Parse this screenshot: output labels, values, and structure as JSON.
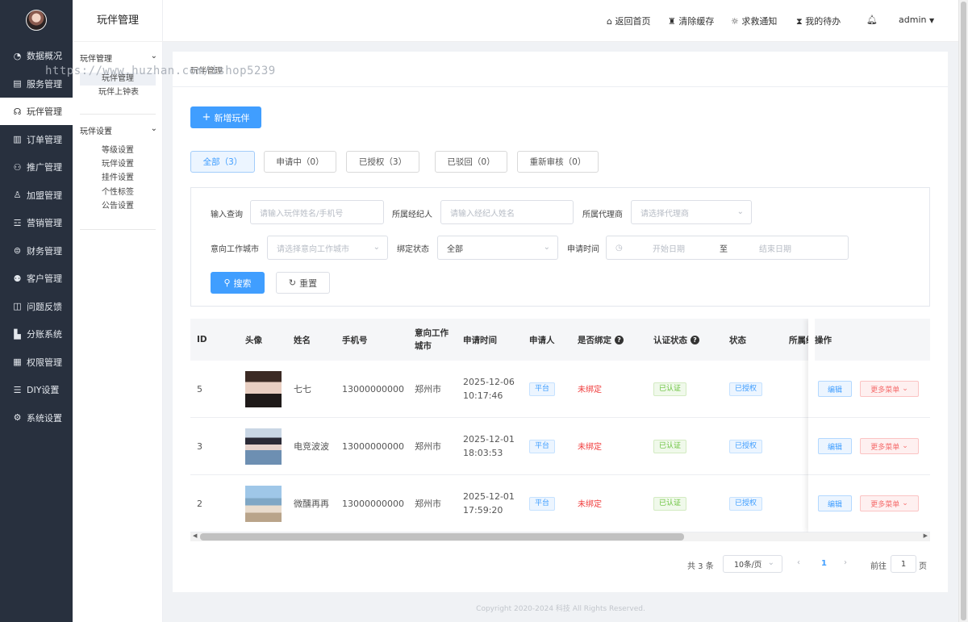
{
  "sidebar": {
    "items": [
      {
        "label": "数据概况",
        "icon": "pie-chart-icon",
        "glyph": "◔"
      },
      {
        "label": "服务管理",
        "icon": "service-icon",
        "glyph": "▤"
      },
      {
        "label": "玩伴管理",
        "icon": "companion-icon",
        "glyph": "☊",
        "active": true
      },
      {
        "label": "订单管理",
        "icon": "order-icon",
        "glyph": "▥"
      },
      {
        "label": "推广管理",
        "icon": "promote-icon",
        "glyph": "⚇"
      },
      {
        "label": "加盟管理",
        "icon": "franchise-icon",
        "glyph": "♙"
      },
      {
        "label": "营销管理",
        "icon": "marketing-icon",
        "glyph": "☲"
      },
      {
        "label": "财务管理",
        "icon": "finance-icon",
        "glyph": "⊜"
      },
      {
        "label": "客户管理",
        "icon": "customer-icon",
        "glyph": "⚉"
      },
      {
        "label": "问题反馈",
        "icon": "feedback-icon",
        "glyph": "◫"
      },
      {
        "label": "分账系统",
        "icon": "split-icon",
        "glyph": "▙"
      },
      {
        "label": "权限管理",
        "icon": "permission-icon",
        "glyph": "▦"
      },
      {
        "label": "DIY设置",
        "icon": "diy-icon",
        "glyph": "☰"
      },
      {
        "label": "系统设置",
        "icon": "settings-icon",
        "glyph": "⚙"
      }
    ]
  },
  "subnav": {
    "title": "玩伴管理",
    "group1": {
      "label": "玩伴管理",
      "items": [
        "玩伴管理",
        "玩伴上钟表"
      ]
    },
    "group2": {
      "label": "玩伴设置",
      "items": [
        "等级设置",
        "玩伴设置",
        "挂件设置",
        "个性标签",
        "公告设置"
      ]
    }
  },
  "topbar": {
    "home": "返回首页",
    "clear_cache": "清除缓存",
    "sos": "求救通知",
    "todo": "我的待办",
    "user": "admin"
  },
  "breadcrumb": "玩伴管理",
  "watermark": "https://www.huzhan.com/ishop5239",
  "add_button": "新增玩伴",
  "tabs": [
    "全部（3）",
    "申请中（0）",
    "已授权（3）",
    "已驳回（0）",
    "重新审核（0）"
  ],
  "filters": {
    "query_label": "输入查询",
    "query_placeholder": "请输入玩伴姓名/手机号",
    "agent_label": "所属经纪人",
    "agent_placeholder": "请输入经纪人姓名",
    "dealer_label": "所属代理商",
    "dealer_placeholder": "请选择代理商",
    "city_label": "意向工作城市",
    "city_placeholder": "请选择意向工作城市",
    "bind_label": "绑定状态",
    "bind_value": "全部",
    "date_label": "申请时间",
    "start_placeholder": "开始日期",
    "date_sep": "至",
    "end_placeholder": "结束日期",
    "search_button": "搜索",
    "reset_button": "重置"
  },
  "table": {
    "columns": [
      "ID",
      "头像",
      "姓名",
      "手机号",
      "意向工作城市",
      "申请时间",
      "申请人",
      "是否绑定",
      "认证状态",
      "状态",
      "所属经",
      "操作"
    ],
    "rows": [
      {
        "id": "5",
        "name": "七七",
        "phone": "13000000000",
        "city": "郑州市",
        "date": "2025-12-06",
        "time": "10:17:46",
        "applicant": "平台",
        "bound": "未绑定",
        "cert": "已认证",
        "status": "已授权"
      },
      {
        "id": "3",
        "name": "电竞波波",
        "phone": "13000000000",
        "city": "郑州市",
        "date": "2025-12-01",
        "time": "18:03:53",
        "applicant": "平台",
        "bound": "未绑定",
        "cert": "已认证",
        "status": "已授权"
      },
      {
        "id": "2",
        "name": "微醺再再",
        "phone": "13000000000",
        "city": "郑州市",
        "date": "2025-12-01",
        "time": "17:59:20",
        "applicant": "平台",
        "bound": "未绑定",
        "cert": "已认证",
        "status": "已授权"
      }
    ],
    "edit_label": "编辑",
    "more_label": "更多菜单"
  },
  "pagination": {
    "total": "共 3 条",
    "page_size": "10条/页",
    "current": "1",
    "goto_label": "前往",
    "goto_value": "1",
    "page_suffix": "页"
  },
  "footer": "Copyright 2020-2024 科技 All Rights Reserved."
}
